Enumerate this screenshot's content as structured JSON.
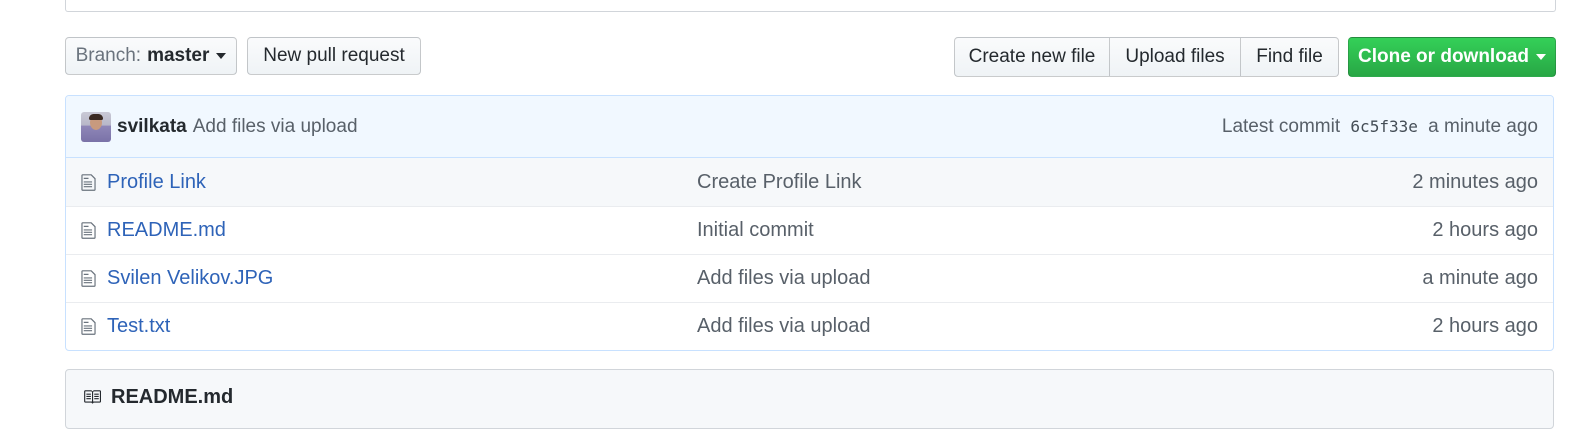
{
  "toolbar": {
    "branch_label": "Branch:",
    "branch_name": "master",
    "new_pull_request": "New pull request",
    "create_new_file": "Create new file",
    "upload_files": "Upload files",
    "find_file": "Find file",
    "clone_or_download": "Clone or download"
  },
  "commit": {
    "author": "svilkata",
    "message": "Add files via upload",
    "latest_label": "Latest commit",
    "sha": "6c5f33e",
    "age": "a minute ago"
  },
  "files": [
    {
      "name": "Profile Link",
      "message": "Create Profile Link",
      "age": "2 minutes ago",
      "icon": "file-icon"
    },
    {
      "name": "README.md",
      "message": "Initial commit",
      "age": "2 hours ago",
      "icon": "file-icon"
    },
    {
      "name": "Svilen Velikov.JPG",
      "message": "Add files via upload",
      "age": "a minute ago",
      "icon": "file-icon"
    },
    {
      "name": "Test.txt",
      "message": "Add files via upload",
      "age": "2 hours ago",
      "icon": "file-icon"
    }
  ],
  "readme": {
    "title": "README.md",
    "icon": "book-icon"
  },
  "colors": {
    "link": "#2e63b8",
    "clone_button": "#2cbe4e",
    "commit_bar": "#f1f8ff"
  }
}
